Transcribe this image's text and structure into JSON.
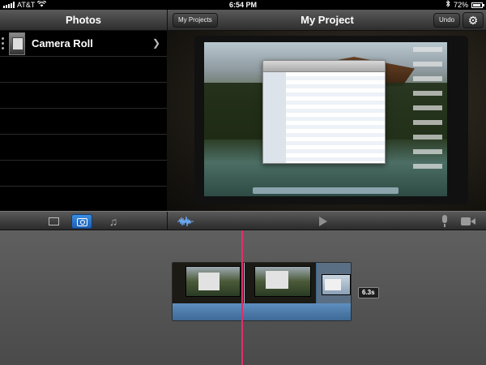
{
  "status_bar": {
    "carrier": "AT&T",
    "time": "6:54 PM",
    "battery": "72%"
  },
  "left_panel": {
    "title": "Photos",
    "albums": [
      {
        "label": "Camera Roll"
      }
    ]
  },
  "right_panel": {
    "my_projects_label": "My Projects",
    "title": "My Project",
    "undo_label": "Undo",
    "settings_icon": "gear-icon"
  },
  "control_bar": {
    "media_tabs": [
      {
        "icon": "video-icon",
        "selected": false
      },
      {
        "icon": "camera-icon",
        "selected": true
      },
      {
        "icon": "music-icon",
        "selected": false
      }
    ],
    "icons": [
      "audio-waveform-icon",
      "play-icon",
      "microphone-icon",
      "video-camera-icon"
    ]
  },
  "timeline": {
    "clip_duration": "6.3s"
  },
  "colors": {
    "playhead": "#e0306a",
    "selected_tab": "#2a72cc",
    "clip_audio_bar": "#3a6591"
  }
}
